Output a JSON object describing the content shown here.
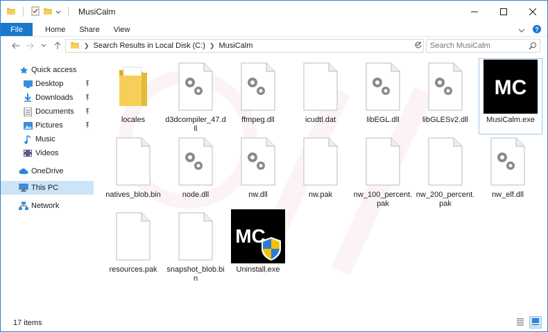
{
  "window": {
    "title": "MusiCalm",
    "accent": "#1979ca"
  },
  "ribbon": {
    "file": "File",
    "home": "Home",
    "share": "Share",
    "view": "View"
  },
  "address": {
    "crumb1": "Search Results in Local Disk (C:)",
    "crumb2": "MusiCalm"
  },
  "search": {
    "placeholder": "Search MusiCalm"
  },
  "sidebar": {
    "items": [
      {
        "label": "Quick access",
        "icon": "star-icon"
      },
      {
        "label": "Desktop",
        "icon": "desktop-folder-icon",
        "pinned": true
      },
      {
        "label": "Downloads",
        "icon": "downloads-folder-icon",
        "pinned": true
      },
      {
        "label": "Documents",
        "icon": "documents-folder-icon",
        "pinned": true
      },
      {
        "label": "Pictures",
        "icon": "pictures-folder-icon",
        "pinned": true
      },
      {
        "label": "Music",
        "icon": "music-folder-icon"
      },
      {
        "label": "Videos",
        "icon": "videos-folder-icon"
      },
      {
        "label": "OneDrive",
        "icon": "cloud-icon"
      },
      {
        "label": "This PC",
        "icon": "computer-icon",
        "selected": true
      },
      {
        "label": "Network",
        "icon": "network-icon"
      }
    ]
  },
  "files": [
    {
      "name": "locales",
      "type": "folder"
    },
    {
      "name": "d3dcompiler_47.dll",
      "type": "dll"
    },
    {
      "name": "ffmpeg.dll",
      "type": "dll"
    },
    {
      "name": "icudtl.dat",
      "type": "blank"
    },
    {
      "name": "libEGL.dll",
      "type": "dll"
    },
    {
      "name": "libGLESv2.dll",
      "type": "dll"
    },
    {
      "name": "MusiCalm.exe",
      "type": "app"
    },
    {
      "name": "natives_blob.bin",
      "type": "blank"
    },
    {
      "name": "node.dll",
      "type": "dll"
    },
    {
      "name": "nw.dll",
      "type": "dll"
    },
    {
      "name": "nw.pak",
      "type": "blank"
    },
    {
      "name": "nw_100_percent.pak",
      "type": "blank"
    },
    {
      "name": "nw_200_percent.pak",
      "type": "blank"
    },
    {
      "name": "nw_elf.dll",
      "type": "dll"
    },
    {
      "name": "resources.pak",
      "type": "blank"
    },
    {
      "name": "snapshot_blob.bin",
      "type": "blank"
    },
    {
      "name": "Uninstall.exe",
      "type": "uninstaller"
    }
  ],
  "status": {
    "count": "17 items"
  },
  "app_logo": {
    "text": "MC",
    "logo_color": "#ffffff",
    "background": "#000000"
  }
}
